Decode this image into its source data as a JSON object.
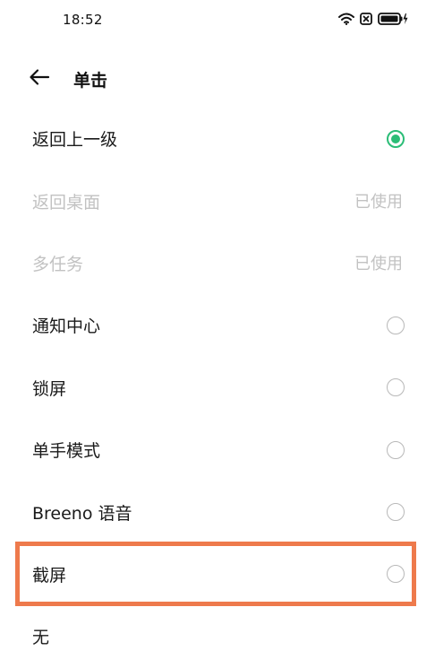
{
  "status_bar": {
    "time": "18:52",
    "icons": [
      "wifi-icon",
      "nfc-icon",
      "battery-charging-icon"
    ]
  },
  "header": {
    "back_icon": "arrow-left-icon",
    "title": "单击"
  },
  "options": [
    {
      "label": "返回上一级",
      "state": "checked"
    },
    {
      "label": "返回桌面",
      "state": "used",
      "used_text": "已使用"
    },
    {
      "label": "多任务",
      "state": "used",
      "used_text": "已使用"
    },
    {
      "label": "通知中心",
      "state": "unchecked"
    },
    {
      "label": "锁屏",
      "state": "unchecked"
    },
    {
      "label": "单手模式",
      "state": "unchecked"
    },
    {
      "label": "Breeno 语音",
      "state": "unchecked"
    },
    {
      "label": "截屏",
      "state": "unchecked"
    },
    {
      "label": "无",
      "state": "unchecked"
    }
  ],
  "colors": {
    "accent": "#2bbd77",
    "highlight": "#ee7a4c",
    "disabled_text": "#c2c2c2"
  }
}
